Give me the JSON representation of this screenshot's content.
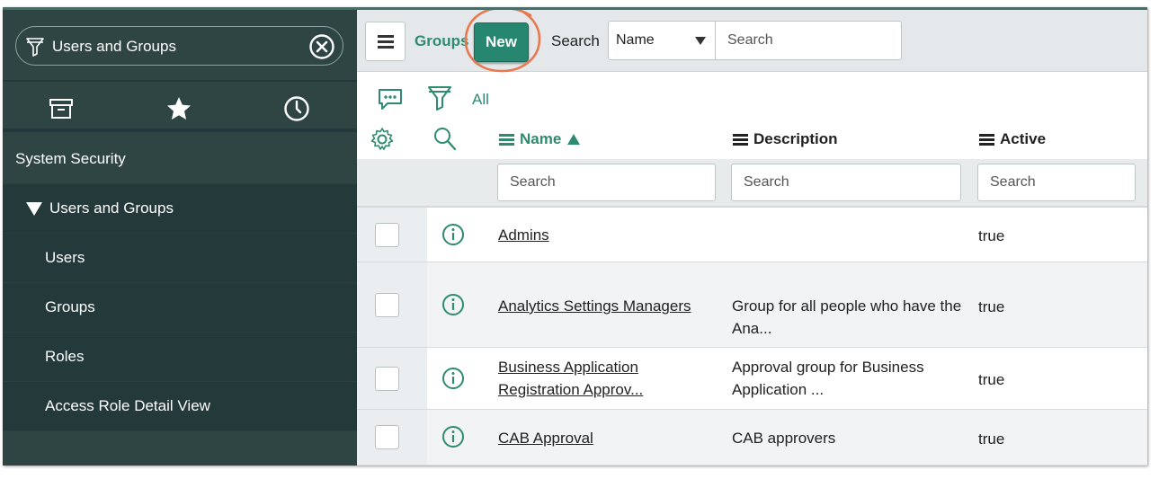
{
  "sidebar": {
    "filter_value": "Users and Groups",
    "icons": [
      "archive-icon",
      "star-icon",
      "clock-icon"
    ],
    "section": "System Security",
    "group": "Users and Groups",
    "items": [
      "Users",
      "Groups",
      "Roles",
      "Access Role Detail View"
    ]
  },
  "toolbar": {
    "title": "Groups",
    "new_label": "New",
    "search_label": "Search",
    "field_select": "Name",
    "search_placeholder": "Search"
  },
  "list": {
    "filter_all": "All",
    "columns": [
      {
        "label": "Name",
        "sort": "ascending"
      },
      {
        "label": "Description"
      },
      {
        "label": "Active"
      }
    ],
    "column_search_placeholder": "Search",
    "rows": [
      {
        "name": "Admins",
        "description": "",
        "active": "true"
      },
      {
        "name": "Analytics Settings Managers",
        "description": "Group for all people who have the Ana...",
        "active": "true"
      },
      {
        "name": "Business Application Registration Approv...",
        "description": "Approval group for Business Application ...",
        "active": "true"
      },
      {
        "name": "CAB Approval",
        "description": "CAB approvers",
        "active": "true"
      }
    ]
  },
  "colors": {
    "sidebar_bg": "#2e4543",
    "sidebar_sub_bg": "#24393a",
    "accent": "#2e8b72",
    "new_button": "#278670",
    "annotation": "#e8784e"
  }
}
